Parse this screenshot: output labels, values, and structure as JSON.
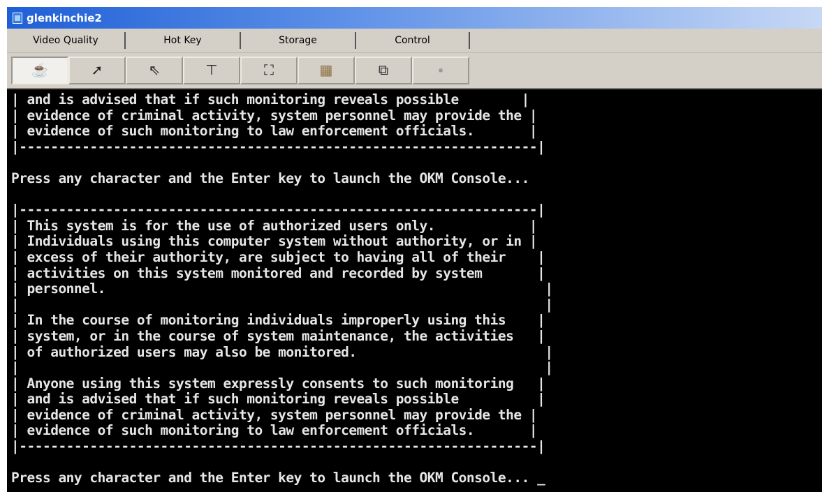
{
  "window": {
    "title": "glenkinchie2"
  },
  "menu": {
    "items": [
      "Video Quality",
      "Hot Key",
      "Storage",
      "Control"
    ]
  },
  "toolbar": {
    "buttons": [
      {
        "icon": "java-cup-icon",
        "glyph": "☕"
      },
      {
        "icon": "cursor-plus-icon",
        "glyph": "➚"
      },
      {
        "icon": "dual-cursor-icon",
        "glyph": "⇖"
      },
      {
        "icon": "align-tool-icon",
        "glyph": "⊤"
      },
      {
        "icon": "fullscreen-icon",
        "glyph": "⛶"
      },
      {
        "icon": "picture-icon",
        "glyph": "▦"
      },
      {
        "icon": "capture-icon",
        "glyph": "⧉"
      },
      {
        "icon": "disabled-tool-icon",
        "glyph": "▪"
      }
    ]
  },
  "console": {
    "lines": [
      "| and is advised that if such monitoring reveals possible        |",
      "| evidence of criminal activity, system personnel may provide the |",
      "| evidence of such monitoring to law enforcement officials.       |",
      "|------------------------------------------------------------------|",
      "",
      "Press any character and the Enter key to launch the OKM Console...",
      "",
      "|------------------------------------------------------------------|",
      "| This system is for the use of authorized users only.            |",
      "| Individuals using this computer system without authority, or in |",
      "| excess of their authority, are subject to having all of their    |",
      "| activities on this system monitored and recorded by system       |",
      "| personnel.                                                        |",
      "|                                                                   |",
      "| In the course of monitoring individuals improperly using this    |",
      "| system, or in the course of system maintenance, the activities   |",
      "| of authorized users may also be monitored.                        |",
      "|                                                                   |",
      "| Anyone using this system expressly consents to such monitoring   |",
      "| and is advised that if such monitoring reveals possible          |",
      "| evidence of criminal activity, system personnel may provide the |",
      "| evidence of such monitoring to law enforcement officials.       |",
      "|------------------------------------------------------------------|",
      "",
      "Press any character and the Enter key to launch the OKM Console... "
    ],
    "cursor": "_"
  }
}
